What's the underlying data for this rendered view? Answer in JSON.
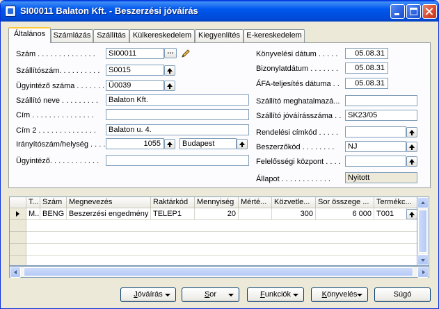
{
  "window": {
    "title": "SI00011 Balaton Kft. - Beszerzési jóváírás"
  },
  "tabs": [
    "Általános",
    "Számlázás",
    "Szállítás",
    "Külkereskedelem",
    "Kiegyenlítés",
    "E-kereskedelem"
  ],
  "left_fields": [
    {
      "label": "Szám . . . . . . . . . . . . . .",
      "value": "SI00011"
    },
    {
      "label": "Szállítószám. . . . . . . . . .",
      "value": "S0015"
    },
    {
      "label": "Ügyintéző száma . . . . . . .",
      "value": "Ü0039"
    },
    {
      "label": "Szállító neve . . . . . . . . .",
      "value": "Balaton Kft."
    },
    {
      "label": "Cím . . . . . . . . . . . . . . .",
      "value": ""
    },
    {
      "label": "Cím 2 . . . . . . . . . . . . . .",
      "value": "Balaton u. 4."
    },
    {
      "label": "Irányítószám/helység . . . .",
      "value": "1055",
      "value2": "Budapest"
    },
    {
      "label": "Ügyintéző. . . . . . . . . . . .",
      "value": ""
    }
  ],
  "right_fields": [
    {
      "label": "Könyvelési dátum . . . . .",
      "value": "05.08.31"
    },
    {
      "label": "Bizonylatdátum . . . . . . .",
      "value": "05.08.31"
    },
    {
      "label": "ÁFA-teljesítés dátuma . .",
      "value": "05.08.31"
    },
    {
      "label": "Szállító meghatalmazá...",
      "value": ""
    },
    {
      "label": "Szállító jóváírásszáma . .",
      "value": "SK23/05"
    },
    {
      "label": "Rendelési címkód . . . . .",
      "value": ""
    },
    {
      "label": "Beszerzőkód . . . . . . . .",
      "value": "NJ"
    },
    {
      "label": "Felelősségi központ . . . .",
      "value": ""
    },
    {
      "label": "Állapot . . . . . . . . . . . .",
      "value": "Nyitott"
    }
  ],
  "lines": {
    "columns": [
      "T...",
      "Szám",
      "Megnevezés",
      "Raktárkód",
      "Mennyiség",
      "Mérté...",
      "Közvetle...",
      "Sor összege ...",
      "Termékc..."
    ],
    "rows": [
      [
        "M...",
        "BENG",
        "Beszerzési engedmény",
        "TELEP1",
        "20",
        "",
        "300",
        "6 000",
        "T001"
      ]
    ]
  },
  "buttons": {
    "credit": {
      "mnemonic": "J",
      "rest": "óváírás"
    },
    "line": {
      "mnemonic": "S",
      "rest": "or"
    },
    "functions": {
      "mnemonic": "F",
      "rest": "unkciók"
    },
    "post": {
      "mnemonic": "K",
      "rest": "önyvelés"
    },
    "help": {
      "label": "Súgó"
    }
  },
  "icons": {
    "lookup": "…",
    "edit": "pencil-icon",
    "drilldown": "up-arrow-icon"
  }
}
